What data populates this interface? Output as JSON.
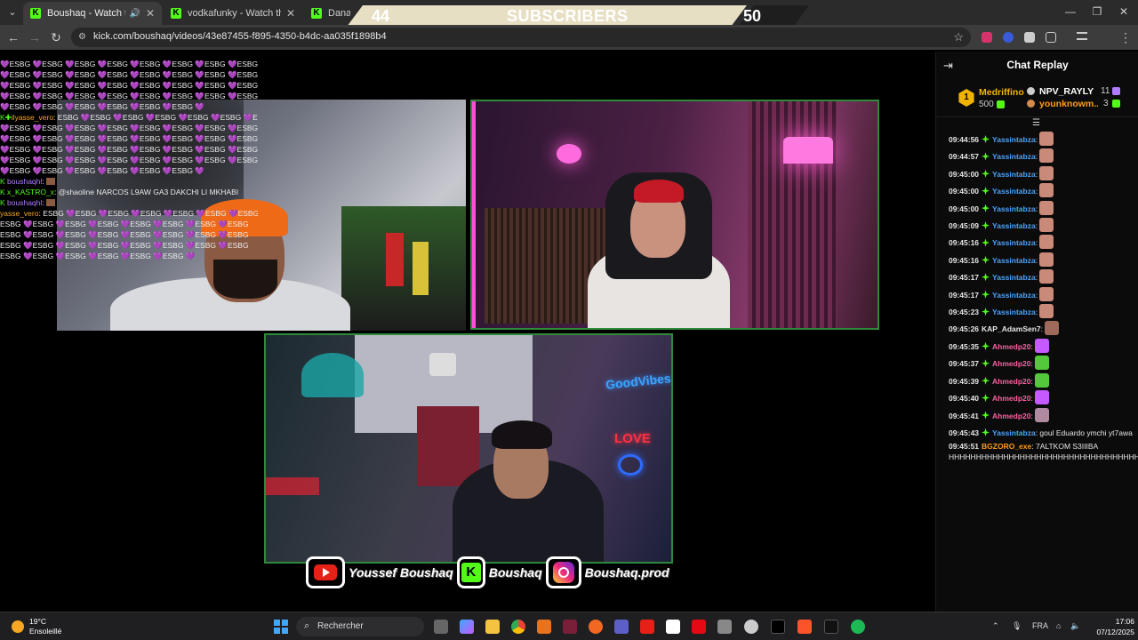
{
  "browser": {
    "tabs": [
      {
        "title": "Boushaq - Watch the VOD o",
        "active": true,
        "audio": true
      },
      {
        "title": "vodkafunky - Watch the VOD o",
        "active": false
      },
      {
        "title": "DanasT",
        "active": false
      }
    ],
    "url": "kick.com/boushaq/videos/43e87455-f895-4350-b4dc-aa035f1898b4",
    "profile_initial": "M"
  },
  "sub_banner": {
    "left_count": "44",
    "label": "SUBSCRIBERS",
    "right_count": "50"
  },
  "overlay_chat": [
    {
      "user": "",
      "text": "💜ESBG 💜ESBG 💜ESBG 💜ESBG 💜ESBG 💜ESBG 💜ESBG 💜ESBG 💜ESBG"
    },
    {
      "user": "",
      "text": "💜ESBG 💜ESBG 💜ESBG 💜ESBG 💜ESBG 💜ESBG 💜ESBG 💜ESBG 💜ESBG"
    },
    {
      "user": "",
      "text": "💜ESBG 💜ESBG 💜ESBG 💜ESBG 💜ESBG 💜ESBG 💜ESBG 💜ESBG 💜ESBG"
    },
    {
      "user": "",
      "text": "💜ESBG 💜ESBG 💜ESBG 💜ESBG 💜ESBG 💜ESBG 💜ESBG 💜ESBG 💜ESBG"
    },
    {
      "user": "",
      "text": "💜ESBG 💜ESBG 💜ESBG 💜ESBG 💜ESBG 💜ESBG 💜"
    },
    {
      "user": "ilyasse_vero",
      "text": ": ESBG 💜ESBG 💜ESBG 💜ESBG 💜ESBG 💜ESBG 💜ESBG 💜ESBG"
    },
    {
      "user": "",
      "text": "💜ESBG 💜ESBG 💜ESBG 💜ESBG 💜ESBG 💜ESBG 💜ESBG 💜ESBG 💜ESBG"
    },
    {
      "user": "",
      "text": "💜ESBG 💜ESBG 💜ESBG 💜ESBG 💜ESBG 💜ESBG 💜ESBG 💜ESBG 💜ESBG"
    },
    {
      "user": "",
      "text": "💜ESBG 💜ESBG 💜ESBG 💜ESBG 💜ESBG 💜ESBG 💜ESBG 💜ESBG 💜ESBG"
    },
    {
      "user": "",
      "text": "💜ESBG 💜ESBG 💜ESBG 💜ESBG 💜ESBG 💜ESBG 💜ESBG 💜ESBG 💜ESBG"
    },
    {
      "user": "",
      "text": "💜ESBG 💜ESBG 💜ESBG 💜ESBG 💜ESBG 💜ESBG 💜"
    },
    {
      "user": "boushaqhl",
      "text": ":"
    },
    {
      "user": "x_KASTRO_x",
      "text": ": @shaoline NARCOS L9AW GA3 DAKCHI LI MKHABI"
    },
    {
      "user": "boushaqhl",
      "text": ":"
    },
    {
      "user": "yasse_vero",
      "text": ": ESBG 💜ESBG 💜ESBG 💜ESBG 💜ESBG 💜ESBG 💜ESBG"
    },
    {
      "user": "",
      "text": "ESBG 💜ESBG 💜ESBG 💜ESBG 💜ESBG 💜ESBG 💜ESBG 💜ESBG"
    },
    {
      "user": "",
      "text": "ESBG 💜ESBG 💜ESBG 💜ESBG 💜ESBG 💜ESBG 💜ESBG 💜ESBG"
    },
    {
      "user": "",
      "text": "ESBG 💜ESBG 💜ESBG 💜ESBG 💜ESBG 💜ESBG 💜ESBG 💜ESBG"
    },
    {
      "user": "",
      "text": "ESBG 💜ESBG 💜ESBG 💜ESBG 💜ESBG 💜ESBG 💜"
    }
  ],
  "social": [
    {
      "platform": "youtube",
      "name": "Youssef Boushaq"
    },
    {
      "platform": "kick",
      "name": "Boushaq"
    },
    {
      "platform": "instagram",
      "name": "Boushaq.prod"
    }
  ],
  "chat": {
    "title": "Chat Replay",
    "leaderboard": {
      "first": {
        "rank": "1",
        "name": "Medriffino",
        "value": "500"
      },
      "second": {
        "name": "NPV_RAYLY",
        "value": "11"
      },
      "third": {
        "name": "younknowm...",
        "value": "3"
      }
    },
    "messages": [
      {
        "time": "09:44:56",
        "user": "Yassintabza",
        "color": "blue",
        "text": ":",
        "emote": "#c98a7a"
      },
      {
        "time": "09:44:57",
        "user": "Yassintabza",
        "color": "blue",
        "text": ":",
        "emote": "#c98a7a"
      },
      {
        "time": "09:45:00",
        "user": "Yassintabza",
        "color": "blue",
        "text": ":",
        "emote": "#c98a7a"
      },
      {
        "time": "09:45:00",
        "user": "Yassintabza",
        "color": "blue",
        "text": ":",
        "emote": "#c98a7a"
      },
      {
        "time": "09:45:00",
        "user": "Yassintabza",
        "color": "blue",
        "text": ":",
        "emote": "#c98a7a"
      },
      {
        "time": "09:45:09",
        "user": "Yassintabza",
        "color": "blue",
        "text": ":",
        "emote": "#c98a7a"
      },
      {
        "time": "09:45:16",
        "user": "Yassintabza",
        "color": "blue",
        "text": ":",
        "emote": "#c98a7a"
      },
      {
        "time": "09:45:16",
        "user": "Yassintabza",
        "color": "blue",
        "text": ":",
        "emote": "#c98a7a"
      },
      {
        "time": "09:45:17",
        "user": "Yassintabza",
        "color": "blue",
        "text": ":",
        "emote": "#c98a7a"
      },
      {
        "time": "09:45:17",
        "user": "Yassintabza",
        "color": "blue",
        "text": ":",
        "emote": "#c98a7a"
      },
      {
        "time": "09:45:23",
        "user": "Yassintabza",
        "color": "blue",
        "text": ":",
        "emote": "#c98a7a"
      },
      {
        "time": "09:45:26",
        "user": "KAP_AdamSen7",
        "color": "white",
        "text": ":",
        "emote": "#a06a5a"
      },
      {
        "time": "09:45:35",
        "user": "Ahmedp20",
        "color": "pink",
        "text": ":",
        "emote": "#c45aff"
      },
      {
        "time": "09:45:37",
        "user": "Ahmedp20",
        "color": "pink",
        "text": ":",
        "emote": "#53c83a"
      },
      {
        "time": "09:45:39",
        "user": "Ahmedp20",
        "color": "pink",
        "text": ":",
        "emote": "#53c83a"
      },
      {
        "time": "09:45:40",
        "user": "Ahmedp20",
        "color": "pink",
        "text": ":",
        "emote": "#c45aff"
      },
      {
        "time": "09:45:41",
        "user": "Ahmedp20",
        "color": "pink",
        "text": ":",
        "emote": "#b08aa0"
      },
      {
        "time": "09:45:43",
        "user": "Yassintabza",
        "color": "blue",
        "text": ": goul Eduardo ymchi yt7awa",
        "emote": ""
      },
      {
        "time": "09:45:51",
        "user": "BGZORO_exe",
        "color": "orange",
        "text": ": 7ALTKOM S3IIIBA HHHHHHHHHHHHHHHHHHHHHHHHHHHHHHHHHHHHHHHHHHHHHHHHHHHHHHHHHHHHHHHHHH",
        "emote": ""
      }
    ]
  },
  "taskbar": {
    "temp": "19°C",
    "weather": "Ensoleillé",
    "search": "Rechercher",
    "lang": "FRA",
    "time": "17:06",
    "date": "07/12/2025"
  }
}
